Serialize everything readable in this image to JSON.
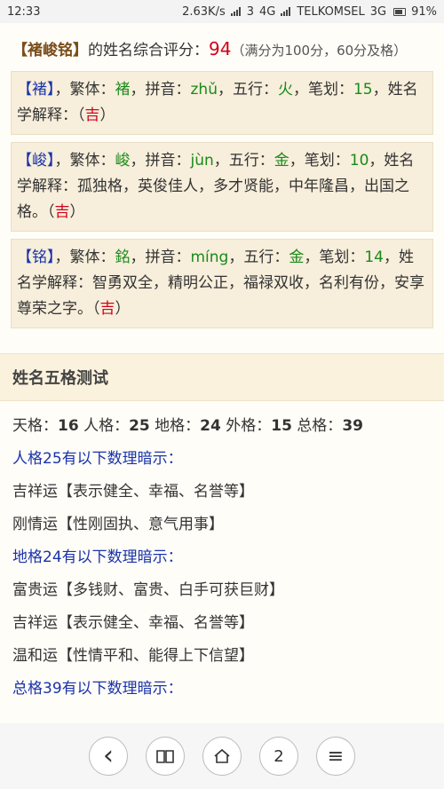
{
  "status": {
    "time": "12:33",
    "speed": "2.63K/s",
    "net1": "3",
    "net1_type": "4G",
    "carrier": "TELKOMSEL",
    "net2_type": "3G",
    "battery": "91%"
  },
  "score": {
    "name_brackets": "【褚峻铭】",
    "label": "的姓名综合评分：",
    "value": "94",
    "note": "（满分为100分，60分及格）"
  },
  "cards": [
    {
      "char_part": "【褚】",
      "text1": "，繁体：",
      "trad": "褚",
      "text2": "，拼音：",
      "pinyin": "zhǔ",
      "text3": "，五行：",
      "wuxing": "火",
      "text4": "，笔划：",
      "strokes": "15",
      "text5": "，姓名学解释：（",
      "result": "吉",
      "text6": "）"
    },
    {
      "char_part": "【峻】",
      "text1": "，繁体：",
      "trad": "峻",
      "text2": "，拼音：",
      "pinyin": "jùn",
      "text3": "，五行：",
      "wuxing": "金",
      "text4": "，笔划：",
      "strokes": "10",
      "text5": "，姓名学解释：孤独格，英俊佳人，多才贤能，中年隆昌，出国之格。（",
      "result": "吉",
      "text6": "）"
    },
    {
      "char_part": "【铭】",
      "text1": "，繁体：",
      "trad": "銘",
      "text2": "，拼音：",
      "pinyin": "míng",
      "text3": "，五行：",
      "wuxing": "金",
      "text4": "，笔划：",
      "strokes": "14",
      "text5": "，姓名学解释：智勇双全，精明公正，福禄双收，名利有份，安享尊荣之字。（",
      "result": "吉",
      "text6": "）"
    }
  ],
  "wuge": {
    "title": "姓名五格测试",
    "tian_label": "天格：",
    "tian": "16",
    "ren_label": "人格：",
    "ren": "25",
    "di_label": "地格：",
    "di": "24",
    "wai_label": "外格：",
    "wai": "15",
    "zong_label": "总格：",
    "zong": "39",
    "lines": [
      {
        "text": "人格25有以下数理暗示：",
        "style": "blue"
      },
      {
        "text": "吉祥运【表示健全、幸福、名誉等】",
        "style": "normal"
      },
      {
        "text": "刚情运【性刚固执、意气用事】",
        "style": "normal"
      },
      {
        "text": "地格24有以下数理暗示：",
        "style": "blue"
      },
      {
        "text": "富贵运【多钱财、富贵、白手可获巨财】",
        "style": "normal"
      },
      {
        "text": "吉祥运【表示健全、幸福、名誉等】",
        "style": "normal"
      },
      {
        "text": "温和运【性情平和、能得上下信望】",
        "style": "normal"
      },
      {
        "text": "总格39有以下数理暗示：",
        "style": "blue"
      }
    ]
  },
  "nav": {
    "back_icon": "‹",
    "book_icon": "📖",
    "home_icon": "⌂",
    "tabs_count": "2",
    "menu_icon": "≡"
  }
}
